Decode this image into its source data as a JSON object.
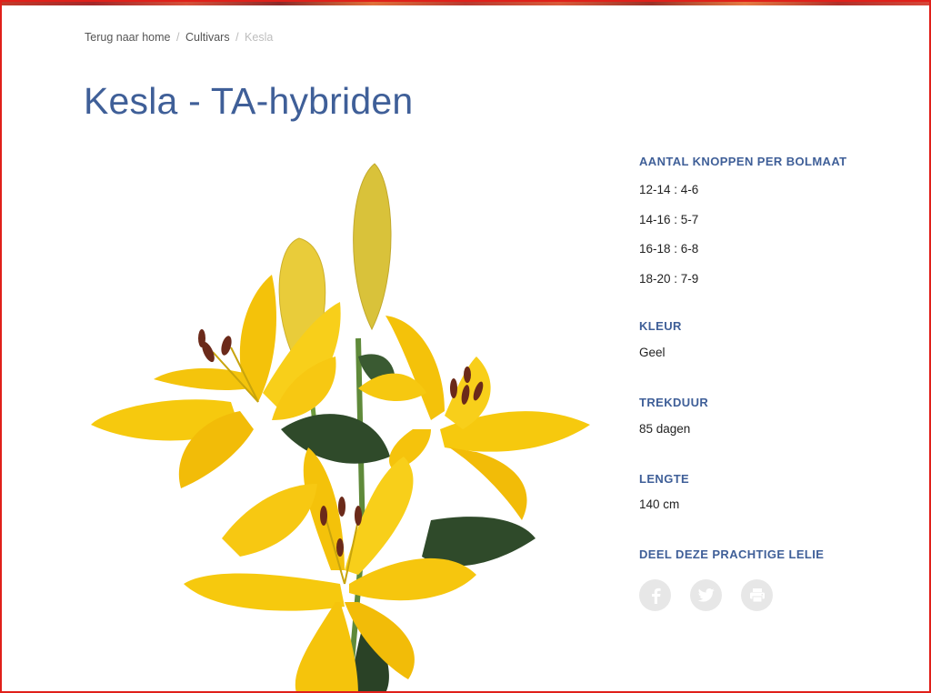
{
  "breadcrumb": {
    "home": "Terug naar home",
    "sep1": "/",
    "category": "Cultivars",
    "sep2": "/",
    "current": "Kesla"
  },
  "page_title": "Kesla - TA-hybriden",
  "specs": {
    "buds_heading": "AANTAL KNOPPEN PER BOLMAAT",
    "buds": [
      "12-14 : 4-6",
      "14-16 : 5-7",
      "16-18 : 6-8",
      "18-20 : 7-9"
    ],
    "color_heading": "KLEUR",
    "color_value": "Geel",
    "forcing_heading": "TREKDUUR",
    "forcing_value": "85 dagen",
    "length_heading": "LENGTE",
    "length_value": "140 cm",
    "share_heading": "DEEL DEZE PRACHTIGE LELIE"
  },
  "share_icons": [
    "facebook-icon",
    "twitter-icon",
    "print-icon"
  ],
  "colors": {
    "title": "#3f5f98",
    "petal": "#f6c90e",
    "leaf": "#2f4a2a",
    "share_bg": "#e7e7e7",
    "frame": "#e0201a"
  }
}
